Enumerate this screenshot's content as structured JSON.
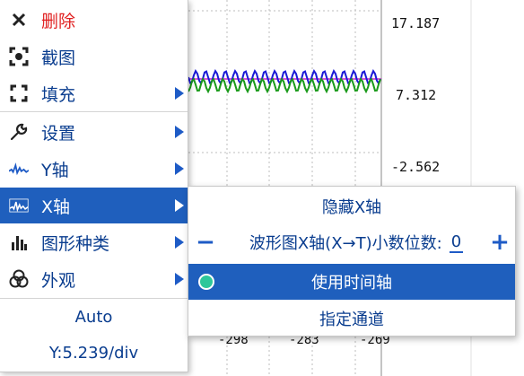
{
  "chart": {
    "y_labels": [
      "17.187",
      "7.312",
      "-2.562"
    ],
    "x_labels": [
      "-298",
      "-283",
      "-269"
    ],
    "colors": {
      "blue": "#1a1ad6",
      "green": "#1a9a1a",
      "magenta": "#cc22cc",
      "grid": "#bdbdbd"
    }
  },
  "menu": {
    "items": [
      {
        "label": "删除",
        "icon": "close-icon",
        "has_submenu": false,
        "color": "#e02020"
      },
      {
        "label": "截图",
        "icon": "screenshot-icon",
        "has_submenu": false
      },
      {
        "label": "填充",
        "icon": "fullscreen-icon",
        "has_submenu": true
      },
      {
        "label": "设置",
        "icon": "wrench-icon",
        "has_submenu": true
      },
      {
        "label": "Y轴",
        "icon": "waveform-icon",
        "has_submenu": true
      },
      {
        "label": "X轴",
        "icon": "x-waveform-icon",
        "has_submenu": true,
        "selected": true
      },
      {
        "label": "图形种类",
        "icon": "bar-chart-icon",
        "has_submenu": true
      },
      {
        "label": "外观",
        "icon": "circles-icon",
        "has_submenu": true
      }
    ],
    "auto_label": "Auto",
    "scale_label": "Y:5.239/div"
  },
  "submenu": {
    "hide_label": "隐藏X轴",
    "minus": "−",
    "decimals_label": "波形图X轴(X→T)小数位数:",
    "decimals_value": "0",
    "plus": "+",
    "time_axis_label": "使用时间轴",
    "time_axis_checked": true,
    "channel_label": "指定通道"
  }
}
